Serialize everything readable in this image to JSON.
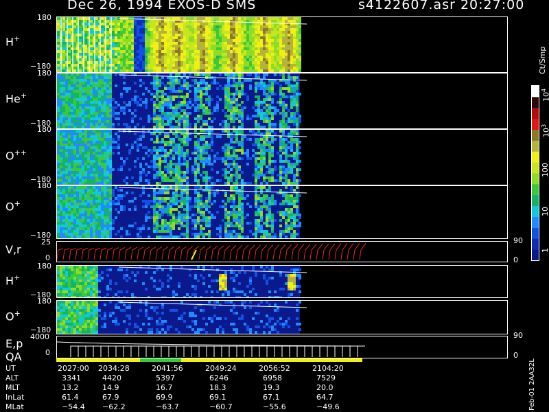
{
  "header": {
    "title": "Dec 26, 1994   EXOS-D SMS",
    "file_time": "s4122607.asr  20:27:00"
  },
  "colorbar": {
    "unit_label": "Ct/Smp",
    "ticks": [
      {
        "label": "10",
        "sup": "4",
        "value": 10000
      },
      {
        "label": "10",
        "sup": "3",
        "value": 1000
      },
      {
        "label": "100",
        "sup": "",
        "value": 100
      },
      {
        "label": "10",
        "sup": "",
        "value": 10
      },
      {
        "label": "1",
        "sup": "",
        "value": 1
      }
    ],
    "colors": [
      "#0a1a8c",
      "#0f2db4",
      "#1450e6",
      "#1e8cff",
      "#14c8dc",
      "#14b464",
      "#3cc83c",
      "#8cdc28",
      "#c8e61e",
      "#f0f014",
      "#b4b43c",
      "#8c7828",
      "#e61414",
      "#b40a0a",
      "#2a0a0a",
      "#ffffff"
    ]
  },
  "panels": [
    {
      "id": "h-plus",
      "ion": "H",
      "charge": "+",
      "ymax": "180",
      "ymin": "−180",
      "tmax_frac": 1.0
    },
    {
      "id": "he-plus",
      "ion": "He",
      "charge": "+",
      "ymax": "180",
      "ymin": "−180",
      "tmax_frac": 1.0
    },
    {
      "id": "o-plusplus",
      "ion": "O",
      "charge": "++",
      "ymax": "180",
      "ymin": "−180",
      "tmax_frac": 1.0
    },
    {
      "id": "o-plus",
      "ion": "O",
      "charge": "+",
      "ymax": "180",
      "ymin": "−180",
      "tmax_frac": 1.0
    },
    {
      "id": "vr",
      "label": "V,r",
      "yleft_top": "25",
      "yleft_bottom": "0",
      "yright_top": "90",
      "yright_bottom": "0"
    },
    {
      "id": "h-plus-2",
      "ion": "H",
      "charge": "+",
      "ymax": "180",
      "ymin": "−180"
    },
    {
      "id": "o-plus-2",
      "ion": "O",
      "charge": "+",
      "ymax": "180",
      "ymin": "−180"
    },
    {
      "id": "ep-qa",
      "label1": "E,p",
      "label2": "QA",
      "yleft_top": "4000",
      "yleft_bottom": "0",
      "yright_top": "90",
      "yright_bottom": "0"
    }
  ],
  "time_axis": {
    "rows": [
      {
        "name": "UT",
        "values": [
          "2027:00",
          "2034:28",
          "2041:56",
          "2049:24",
          "2056:52",
          "2104:20"
        ]
      },
      {
        "name": "ALT",
        "values": [
          "3341",
          "4420",
          "5397",
          "6246",
          "6958",
          "7529"
        ]
      },
      {
        "name": "MLT",
        "values": [
          "13.2",
          "14.9",
          "16.7",
          "18.3",
          "19.3",
          "20.0"
        ]
      },
      {
        "name": "InLat",
        "values": [
          "61.4",
          "67.9",
          "69.9",
          "69.1",
          "67.1",
          "64.7"
        ]
      },
      {
        "name": "MLat",
        "values": [
          "−54.4",
          "−62.2",
          "−63.7",
          "−60.7",
          "−55.6",
          "−49.6"
        ]
      }
    ]
  },
  "stamp": "Feb-01 2AA32L",
  "chart_data": {
    "type": "heatmap",
    "title": "Dec 26, 1994   EXOS-D SMS",
    "x": [
      "2027:00",
      "2034:28",
      "2041:56",
      "2049:24",
      "2056:52",
      "2104:20"
    ],
    "x_fraction_with_data": 0.54,
    "series": [
      {
        "name": "H+",
        "yrange": [
          -180,
          180
        ]
      },
      {
        "name": "He+",
        "yrange": [
          -180,
          180
        ]
      },
      {
        "name": "O++",
        "yrange": [
          -180,
          180
        ]
      },
      {
        "name": "O+",
        "yrange": [
          -180,
          180
        ]
      },
      {
        "name": "V,r",
        "yrange": [
          0,
          25
        ]
      },
      {
        "name": "H+",
        "yrange": [
          -180,
          180
        ]
      },
      {
        "name": "O+",
        "yrange": [
          -180,
          180
        ]
      },
      {
        "name": "E,p",
        "yrange": [
          0,
          4000
        ]
      }
    ],
    "colorbar_range": [
      1,
      10000
    ],
    "colorbar_scale": "log"
  }
}
